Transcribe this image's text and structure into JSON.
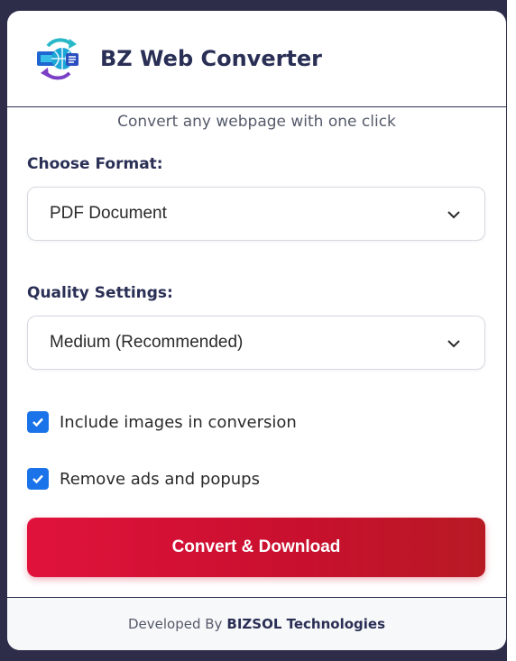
{
  "app": {
    "title": "BZ Web Converter"
  },
  "subtitle": "Convert any webpage with one click",
  "format": {
    "label": "Choose Format:",
    "selected": "PDF Document"
  },
  "quality": {
    "label": "Quality Settings:",
    "selected": "Medium (Recommended)"
  },
  "options": [
    {
      "label": "Include images in conversion",
      "checked": true
    },
    {
      "label": "Remove ads and popups",
      "checked": true
    }
  ],
  "convert_button": "Convert & Download",
  "footer": {
    "prefix": "Developed By",
    "brand": "BIZSOL Technologies"
  },
  "colors": {
    "primary": "#2a2f55",
    "accent": "#c8102e",
    "checkbox": "#1a73e8"
  },
  "icons": {
    "logo": "globe-convert-logo-icon",
    "select_chevron": "chevron-down-icon",
    "checkmark": "checkmark-icon"
  }
}
